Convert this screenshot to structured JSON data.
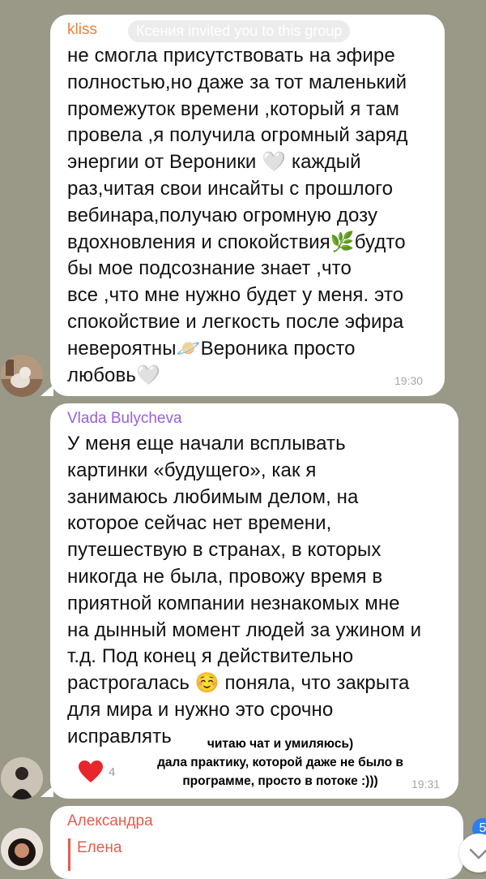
{
  "messages": [
    {
      "sender": "kliss",
      "service_notice": "Ксения invited you to this group",
      "text": "не смогла присутствовать на эфире\nполностью,но даже за тот маленький\nпромежуток времени ,который я там\nпровела ,я получила огромный заряд\nэнергии от Вероники 🤍 каждый\nраз,читая свои инсайты с прошлого\nвебинара,получаю огромную дозу\nвдохновления и спокойствия🌿будто\nбы мое подсознание знает ,что\nвсе ,что мне нужно будет у меня. это\nспокойствие и легкость после эфира\nневероятны🪐Вероника просто\nлюбовь🤍",
      "time": "19:30"
    },
    {
      "sender": "Vlada Bulycheva",
      "text": "У меня еще начали всплывать\nкартинки «будущего», как я\nзанимаюсь любимым делом, на\nкоторое сейчас нет времени,\nпутешествую в странах, в которых\nникогда не была, провожу время в\nприятной компании незнакомых мне\nна дынный момент людей за ужином и\nт.д. Под конец я действительно\nрастрогалась ☺️ поняла, что закрыта\nдля мира и нужно это срочно\nисправлять",
      "reaction_emoji": "❤️",
      "reaction_count": "4",
      "time": "19:31"
    },
    {
      "sender": "Александра",
      "reply_to": "Елена"
    }
  ],
  "overlay_caption": "читаю чат и умиляюсь)\nдала практику, которой даже не было в\nпрограмме, просто в потоке :)))",
  "unread_badge": "5",
  "colors": {
    "background": "#9a9887",
    "bubble": "#ffffff",
    "sender_kliss": "#e8843a",
    "sender_vlada": "#9b5fd6",
    "sender_alexandra": "#e25c4e",
    "time": "#a8a8a8"
  }
}
